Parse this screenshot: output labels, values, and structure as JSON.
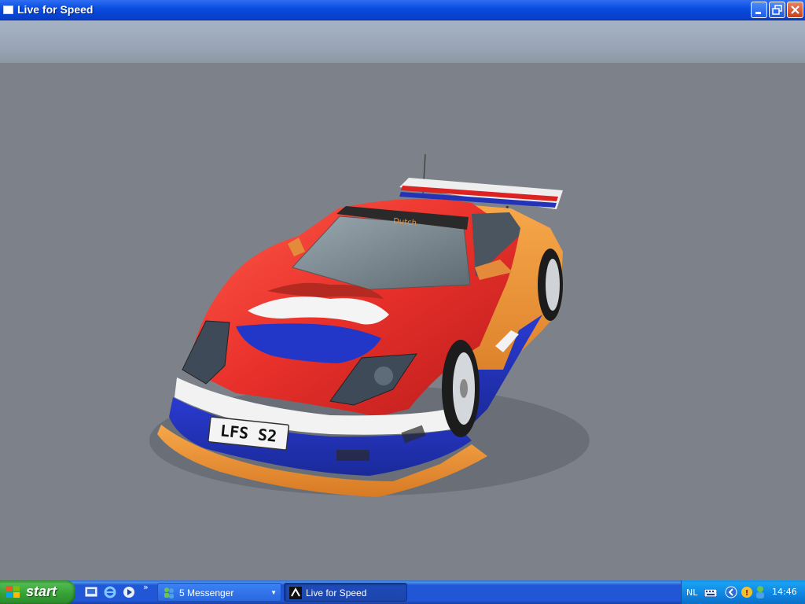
{
  "window": {
    "title": "Live for Speed"
  },
  "scene": {
    "license_plate": "LFS S2",
    "windshield_banner": "Dutch"
  },
  "taskbar": {
    "start_label": "start",
    "tasks": [
      {
        "label": "5 Messenger",
        "icon": "messenger-icon"
      },
      {
        "label": "Live for Speed",
        "icon": "lfs-icon"
      }
    ],
    "language": "NL",
    "clock": "14:46"
  }
}
